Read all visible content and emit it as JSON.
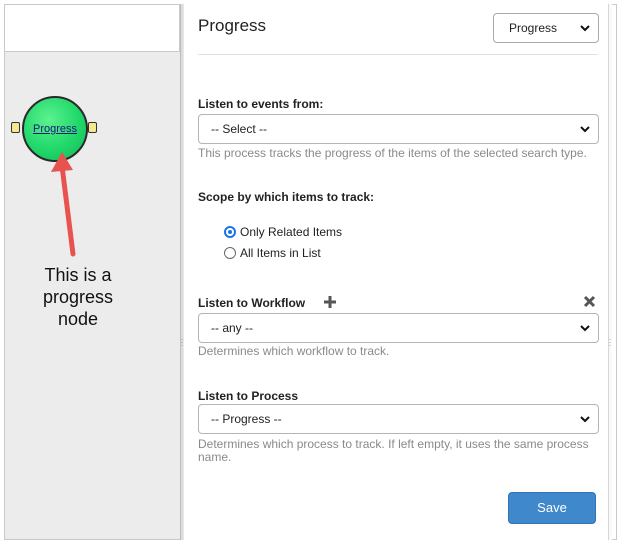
{
  "canvas": {
    "node": {
      "label": "Progress",
      "color": "#20d86a"
    },
    "annotation": {
      "lines": [
        "This is a",
        "progress",
        "node"
      ]
    }
  },
  "panel": {
    "title": "Progress",
    "type_select": {
      "value": "Progress"
    },
    "events": {
      "label": "Listen to events from:",
      "value": "-- Select --",
      "help": "This process tracks the progress of the items of the selected search type."
    },
    "scope": {
      "label": "Scope by which items to track:",
      "options": [
        {
          "label": "Only Related Items",
          "checked": true
        },
        {
          "label": "All Items in List",
          "checked": false
        }
      ]
    },
    "workflow": {
      "label": "Listen to Workflow",
      "value": "-- any --",
      "help": "Determines which workflow to track."
    },
    "process": {
      "label": "Listen to Process",
      "value": "-- Progress --",
      "help": "Determines which process to track. If left empty, it uses the same process name."
    },
    "save_label": "Save",
    "accent": "#3f88cc"
  }
}
